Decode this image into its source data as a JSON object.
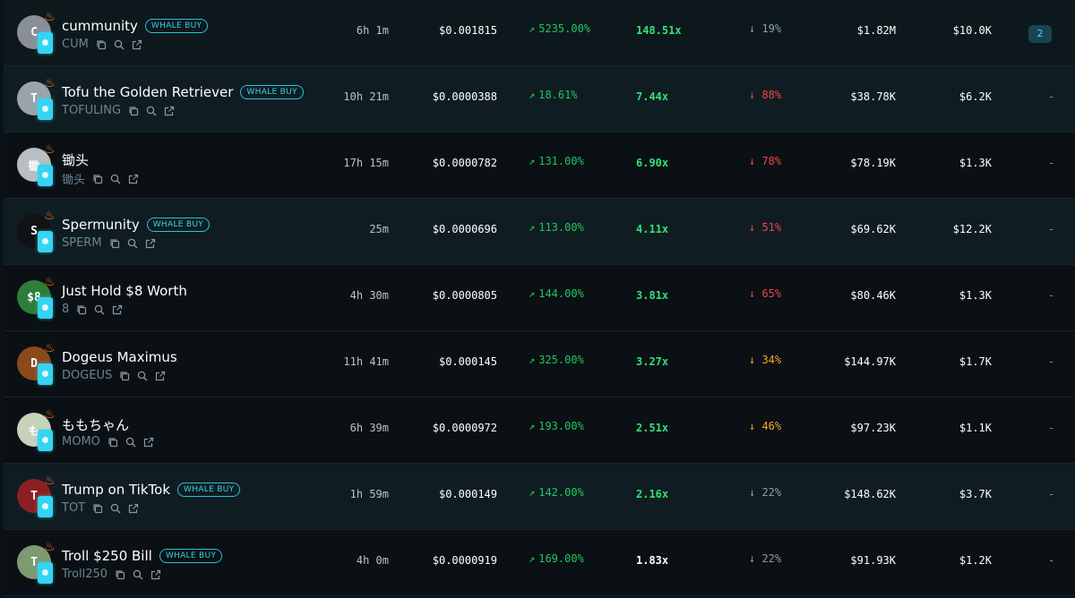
{
  "colors": {
    "green": "#22c55e",
    "green_bright": "#33e176",
    "white": "#ffffff",
    "red": "#f04444",
    "orange": "#f5a623",
    "gray": "#8c9ba7",
    "whale_badge": "#35d4e6",
    "chip_cyan": "#35d4f2"
  },
  "rows": [
    {
      "name": "cummunity",
      "ticker": "CUM",
      "whale_buy": "WHALE BUY",
      "age": "6h 1m",
      "price": "$0.001815",
      "change": "5235.00%",
      "multiplier": "148.51x",
      "multiplier_color": "#33e176",
      "drop": "19%",
      "drop_color": "#8c9ba7",
      "mcap": "$1.82M",
      "volume": "$10.0K",
      "action": "2",
      "avatar_letter": "C",
      "avatar_color": "#8a8f96"
    },
    {
      "name": "Tofu the Golden Retriever",
      "ticker": "TOFULING",
      "whale_buy": "WHALE BUY",
      "age": "10h 21m",
      "price": "$0.0000388",
      "change": "18.61%",
      "multiplier": "7.44x",
      "multiplier_color": "#33e176",
      "drop": "88%",
      "drop_color": "#f04444",
      "mcap": "$38.78K",
      "volume": "$6.2K",
      "action": "-",
      "avatar_letter": "T",
      "avatar_color": "#9aa3aa"
    },
    {
      "name": "锄头",
      "ticker": "锄头",
      "whale_buy": "",
      "age": "17h 15m",
      "price": "$0.0000782",
      "change": "131.00%",
      "multiplier": "6.90x",
      "multiplier_color": "#33e176",
      "drop": "78%",
      "drop_color": "#f04444",
      "mcap": "$78.19K",
      "volume": "$1.3K",
      "action": "-",
      "avatar_letter": "锄",
      "avatar_color": "#b9bec3"
    },
    {
      "name": "Spermunity",
      "ticker": "SPERM",
      "whale_buy": "WHALE BUY",
      "age": "25m",
      "price": "$0.0000696",
      "change": "113.00%",
      "multiplier": "4.11x",
      "multiplier_color": "#33e176",
      "drop": "51%",
      "drop_color": "#f04444",
      "mcap": "$69.62K",
      "volume": "$12.2K",
      "action": "-",
      "avatar_letter": "S",
      "avatar_color": "#101214"
    },
    {
      "name": "Just Hold $8 Worth",
      "ticker": "8",
      "whale_buy": "",
      "age": "4h 30m",
      "price": "$0.0000805",
      "change": "144.00%",
      "multiplier": "3.81x",
      "multiplier_color": "#33e176",
      "drop": "65%",
      "drop_color": "#f04444",
      "mcap": "$80.46K",
      "volume": "$1.3K",
      "action": "-",
      "avatar_letter": "$8",
      "avatar_color": "#2f7d3a"
    },
    {
      "name": "Dogeus Maximus",
      "ticker": "DOGEUS",
      "whale_buy": "",
      "age": "11h 41m",
      "price": "$0.000145",
      "change": "325.00%",
      "multiplier": "3.27x",
      "multiplier_color": "#33e176",
      "drop": "34%",
      "drop_color": "#f5a623",
      "mcap": "$144.97K",
      "volume": "$1.7K",
      "action": "-",
      "avatar_letter": "D",
      "avatar_color": "#8a4a1c"
    },
    {
      "name": "ももちゃん",
      "ticker": "MOMO",
      "whale_buy": "",
      "age": "6h 39m",
      "price": "$0.0000972",
      "change": "193.00%",
      "multiplier": "2.51x",
      "multiplier_color": "#33e176",
      "drop": "46%",
      "drop_color": "#f5a623",
      "mcap": "$97.23K",
      "volume": "$1.1K",
      "action": "-",
      "avatar_letter": "も",
      "avatar_color": "#c7d3b8"
    },
    {
      "name": "Trump on TikTok",
      "ticker": "TOT",
      "whale_buy": "WHALE BUY",
      "age": "1h 59m",
      "price": "$0.000149",
      "change": "142.00%",
      "multiplier": "2.16x",
      "multiplier_color": "#33e176",
      "drop": "22%",
      "drop_color": "#8c9ba7",
      "mcap": "$148.62K",
      "volume": "$3.7K",
      "action": "-",
      "avatar_letter": "T",
      "avatar_color": "#8c1f22"
    },
    {
      "name": "Troll $250 Bill",
      "ticker": "Troll250",
      "whale_buy": "WHALE BUY",
      "age": "4h 0m",
      "price": "$0.0000919",
      "change": "169.00%",
      "multiplier": "1.83x",
      "multiplier_color": "#ffffff",
      "drop": "22%",
      "drop_color": "#8c9ba7",
      "mcap": "$91.93K",
      "volume": "$1.2K",
      "action": "-",
      "avatar_letter": "T",
      "avatar_color": "#7f9a72"
    }
  ]
}
